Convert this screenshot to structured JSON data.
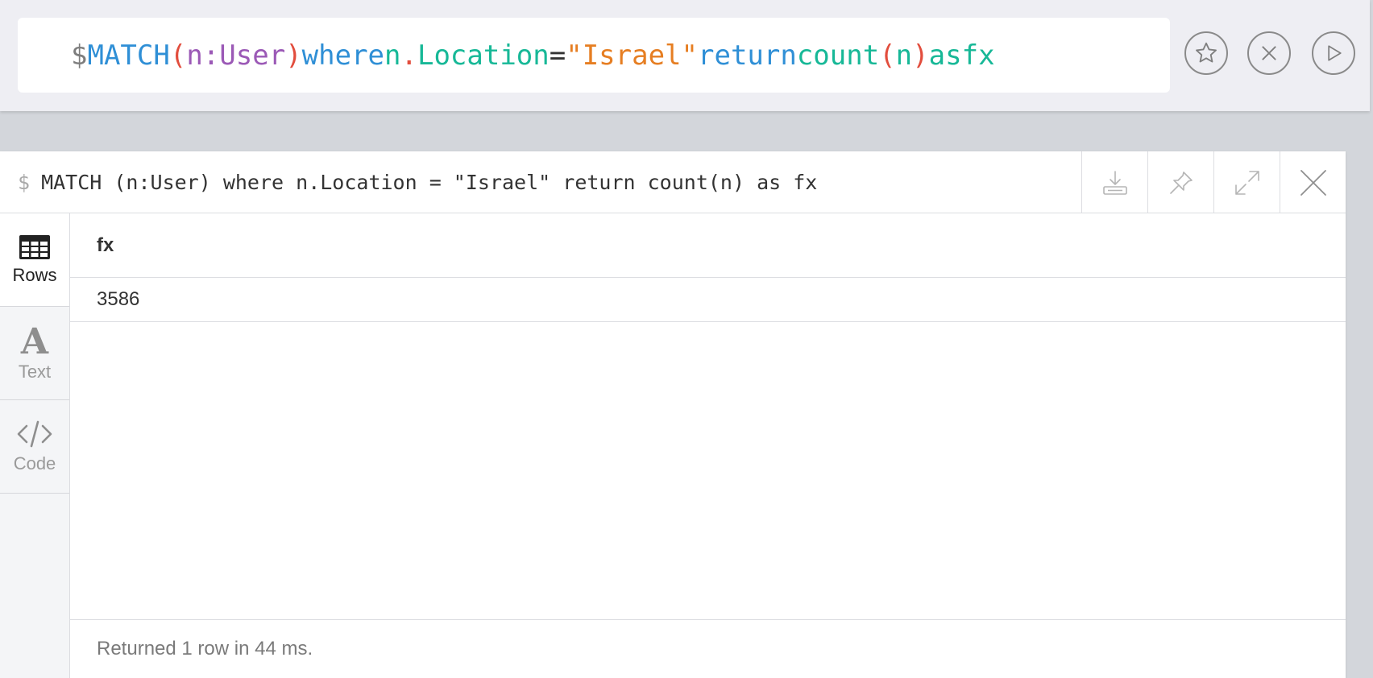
{
  "editor": {
    "prompt": "$",
    "tokens": {
      "match": "MATCH",
      "open_paren": "(",
      "node_var": "n:",
      "node_label": "User",
      "close_paren": ")",
      "where": "where",
      "prop_var": "n",
      "dot": ".",
      "prop_name": "Location",
      "equals": "=",
      "string_value": "\"Israel\"",
      "return_kw": "return",
      "count_fn": "count",
      "count_open": "(",
      "count_arg": "n",
      "count_close": ")",
      "as_kw": "as",
      "alias": "fx"
    },
    "buttons": {
      "favorite_icon": "star-icon",
      "clear_icon": "close-icon",
      "run_icon": "play-icon"
    }
  },
  "frame": {
    "prompt": "$",
    "query": "MATCH (n:User) where n.Location = \"Israel\" return count(n) as fx",
    "actions": [
      "download-icon",
      "pin-icon",
      "expand-icon",
      "close-icon"
    ]
  },
  "sidebar": {
    "tabs": [
      {
        "label": "Rows",
        "icon": "table-icon",
        "active": true
      },
      {
        "label": "Text",
        "icon": "text-icon",
        "active": false
      },
      {
        "label": "Code",
        "icon": "code-icon",
        "active": false
      }
    ]
  },
  "table": {
    "columns": [
      "fx"
    ],
    "rows": [
      [
        "3586"
      ]
    ]
  },
  "status": {
    "message": "Returned 1 row in 44 ms."
  },
  "colors": {
    "keyword": "#2f8fd6",
    "paren": "#e24d3d",
    "label": "#9b59b6",
    "identifier": "#17b897",
    "string": "#e67e22"
  }
}
